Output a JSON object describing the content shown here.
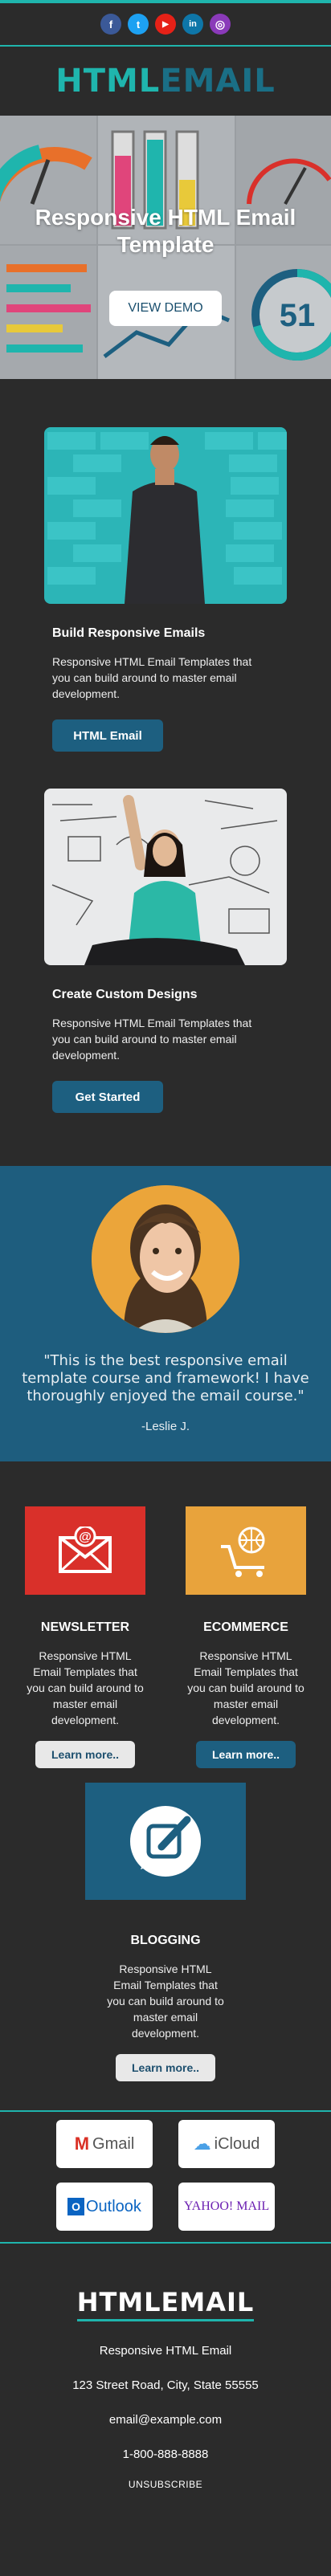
{
  "social": {
    "icons": [
      {
        "name": "facebook-icon",
        "glyph": "f",
        "color": "#3b5998"
      },
      {
        "name": "twitter-icon",
        "glyph": "t",
        "color": "#1da1f2"
      },
      {
        "name": "youtube-icon",
        "glyph": "▶",
        "color": "#e62117"
      },
      {
        "name": "linkedin-icon",
        "glyph": "in",
        "color": "#0e76a8"
      },
      {
        "name": "instagram-icon",
        "glyph": "◎",
        "color": "#8a3ab9"
      }
    ]
  },
  "header": {
    "logo_part1": "HTML",
    "logo_part2": "EMAIL"
  },
  "hero": {
    "title": "Responsive HTML Email Template",
    "button": "VIEW DEMO",
    "gauge_number": "51"
  },
  "cards": [
    {
      "title": "Build Responsive Emails",
      "text": "Responsive HTML Email Templates that you can build around to master email development.",
      "button": "HTML Email"
    },
    {
      "title": "Create Custom Designs",
      "text": "Responsive HTML Email Templates that you can build around to master email development.",
      "button": "Get Started"
    }
  ],
  "testimonial": {
    "quote": "\"This is the best responsive email template course and framework! I have thoroughly enjoyed the email course.\"",
    "author": "-Leslie J."
  },
  "features": [
    {
      "title": "NEWSLETTER",
      "text": "Responsive HTML Email Templates that you can build around to master email development.",
      "button": "Learn more..",
      "color": "#d9302a"
    },
    {
      "title": "ECOMMERCE",
      "text": "Responsive HTML Email Templates that you can build around to master email development.",
      "button": "Learn more..",
      "color": "#e8a33c"
    },
    {
      "title": "BLOGGING",
      "text": "Responsive HTML Email Templates that you can build around to master email development.",
      "button": "Learn more..",
      "color": "#1d5f80"
    }
  ],
  "clients": [
    "Gmail",
    "iCloud",
    "Outlook",
    "YAHOO! MAIL"
  ],
  "footer": {
    "logo": "HTMLEMAIL",
    "name": "Responsive HTML Email",
    "address": "123 Street Road, City, State 55555",
    "email": "email@example.com",
    "phone": "1-800-888-8888",
    "unsubscribe": "UNSUBSCRIBE"
  },
  "colors": {
    "accent": "#1fb5ad",
    "brand_dark": "#1d5f80",
    "background": "#2b2b2b"
  }
}
